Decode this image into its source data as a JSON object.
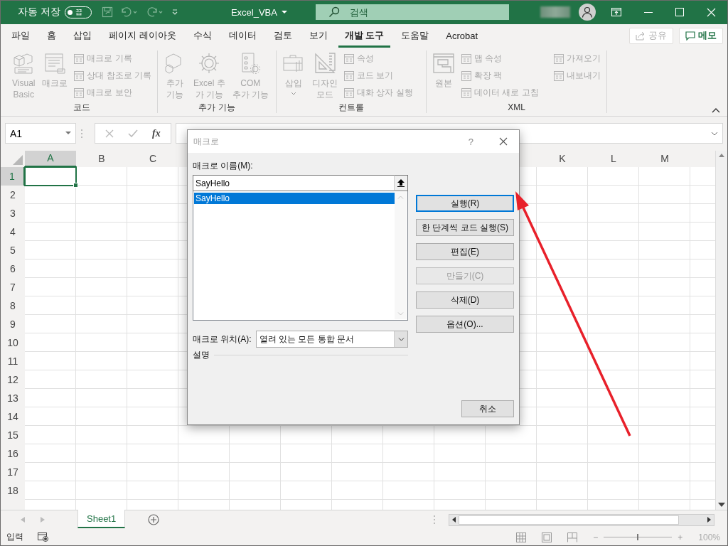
{
  "title_bar": {
    "autosave_label": "자동 저장",
    "autosave": {
      "on": false,
      "label": "끔"
    },
    "title": "Excel_VBA",
    "search": {
      "placeholder": "검색"
    }
  },
  "tabs": [
    {
      "label": "파일",
      "selected": false
    },
    {
      "label": "홈",
      "selected": false
    },
    {
      "label": "삽입",
      "selected": false
    },
    {
      "label": "페이지 레이아웃",
      "selected": false
    },
    {
      "label": "수식",
      "selected": false
    },
    {
      "label": "데이터",
      "selected": false
    },
    {
      "label": "검토",
      "selected": false
    },
    {
      "label": "보기",
      "selected": false
    },
    {
      "label": "개발 도구",
      "selected": true
    },
    {
      "label": "도움말",
      "selected": false
    },
    {
      "label": "Acrobat",
      "selected": false
    }
  ],
  "share_button": {
    "label": "공유",
    "disabled": true
  },
  "comments_button": {
    "label": "메모"
  },
  "ribbon": {
    "groups": [
      {
        "label": "코드",
        "items": [
          {
            "kind": "large",
            "label": "Visual\nBasic",
            "disabled": true
          },
          {
            "kind": "large",
            "label": "매크로",
            "disabled": true
          },
          {
            "kind": "small",
            "label": "매크로 기록",
            "disabled": true
          },
          {
            "kind": "small",
            "label": "상대 참조로 기록",
            "disabled": true
          },
          {
            "kind": "small",
            "label": "매크로 보안",
            "disabled": true
          }
        ]
      },
      {
        "label": "추가 기능",
        "items": [
          {
            "kind": "large",
            "label": "추가\n기능",
            "disabled": true
          },
          {
            "kind": "large",
            "label": "Excel 추\n가 기능",
            "disabled": true
          },
          {
            "kind": "large",
            "label": "COM\n추가 기능",
            "disabled": true
          }
        ]
      },
      {
        "label": "컨트롤",
        "items": [
          {
            "kind": "dropdown",
            "label": "삽입",
            "disabled": true
          },
          {
            "kind": "large",
            "label": "디자인\n모드",
            "disabled": true
          },
          {
            "kind": "small",
            "label": "속성",
            "disabled": true
          },
          {
            "kind": "small",
            "label": "코드 보기",
            "disabled": true
          },
          {
            "kind": "small",
            "label": "대화 상자 실행",
            "disabled": true
          }
        ]
      },
      {
        "label": "XML",
        "items": [
          {
            "kind": "large",
            "label": "원본",
            "disabled": true
          },
          {
            "kind": "small",
            "label": "맵 속성",
            "disabled": true
          },
          {
            "kind": "small",
            "label": "확장 팩",
            "disabled": true
          },
          {
            "kind": "small",
            "label": "데이터 새로 고침",
            "disabled": true
          },
          {
            "kind": "small",
            "label": "가져오기",
            "disabled": true
          },
          {
            "kind": "small",
            "label": "내보내기",
            "disabled": true
          }
        ]
      }
    ]
  },
  "formula_bar": {
    "name_box": "A1",
    "function_label": "fx"
  },
  "sheet": {
    "columns": [
      {
        "label": "A",
        "selected": true
      },
      {
        "label": "B",
        "selected": false
      },
      {
        "label": "C",
        "selected": false
      },
      {
        "label": "K",
        "selected": false
      },
      {
        "label": "L",
        "selected": false
      },
      {
        "label": "M",
        "selected": false
      }
    ],
    "rows": [
      {
        "label": "1",
        "selected": true
      },
      {
        "label": "2",
        "selected": false
      },
      {
        "label": "3",
        "selected": false
      },
      {
        "label": "4",
        "selected": false
      },
      {
        "label": "5",
        "selected": false
      },
      {
        "label": "6",
        "selected": false
      },
      {
        "label": "7",
        "selected": false
      },
      {
        "label": "8",
        "selected": false
      },
      {
        "label": "9",
        "selected": false
      },
      {
        "label": "10",
        "selected": false
      },
      {
        "label": "11",
        "selected": false
      },
      {
        "label": "12",
        "selected": false
      },
      {
        "label": "13",
        "selected": false
      },
      {
        "label": "14",
        "selected": false
      },
      {
        "label": "15",
        "selected": false
      },
      {
        "label": "16",
        "selected": false
      },
      {
        "label": "17",
        "selected": false
      },
      {
        "label": "18",
        "selected": false
      }
    ]
  },
  "sheet_tabs": [
    {
      "label": "Sheet1",
      "selected": true
    }
  ],
  "status_bar": {
    "mode": "입력",
    "zoom_minus": "−",
    "zoom_plus": "+",
    "zoom": {
      "level": 0.5
    },
    "zoom_reading": "100%"
  },
  "dialog": {
    "title": "매크로",
    "help": "?",
    "name_label": "매크로 이름(M):",
    "name_value": "SayHello",
    "macros": [
      {
        "label": "SayHello",
        "selected": true
      }
    ],
    "buttons": [
      {
        "label": "실행(R)",
        "default": true,
        "disabled": false
      },
      {
        "label": "한 단계씩 코드 실행(S)",
        "default": false,
        "disabled": false
      },
      {
        "label": "편집(E)",
        "default": false,
        "disabled": false
      },
      {
        "label": "만들기(C)",
        "default": false,
        "disabled": true
      },
      {
        "label": "삭제(D)",
        "default": false,
        "disabled": false
      },
      {
        "label": "옵션(O)...",
        "default": false,
        "disabled": false
      }
    ],
    "location_label": "매크로 위치(A):",
    "location_value": "열려 있는 모든 통합 문서",
    "description_label": "설명",
    "cancel": "취소"
  }
}
